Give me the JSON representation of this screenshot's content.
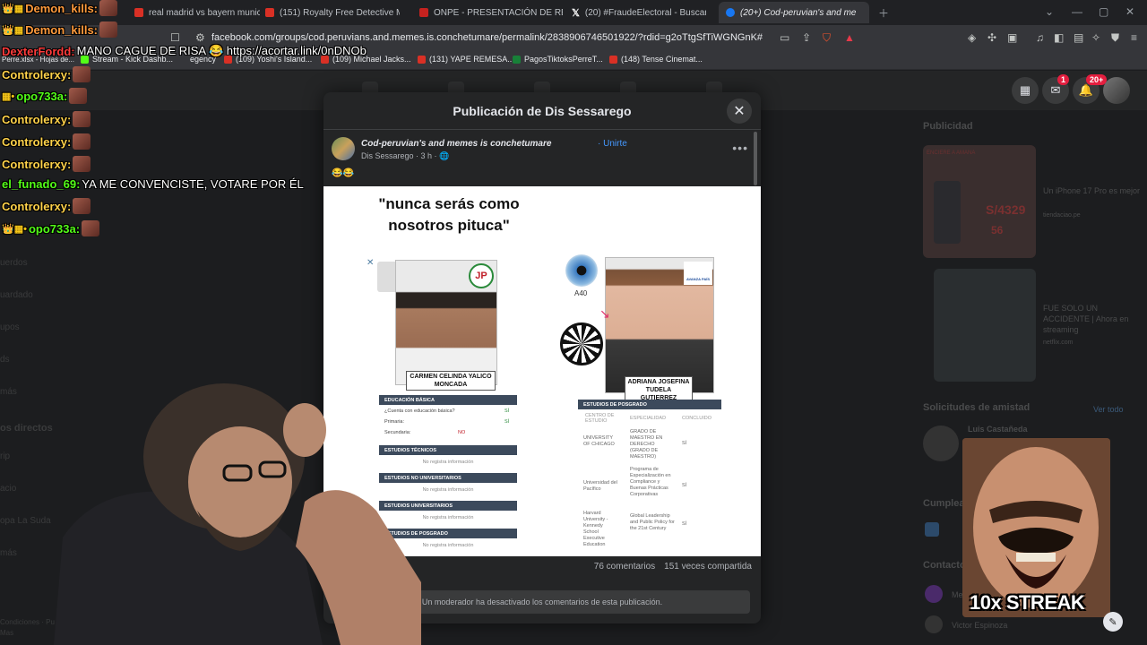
{
  "browser": {
    "tabs": [
      {
        "label": "real madrid vs bayern munich",
        "color": "#d93025"
      },
      {
        "label": "(151) Royalty Free Detective Mu",
        "color": "#d93025"
      },
      {
        "label": "ONPE - PRESENTACIÓN DE RESULTA",
        "color": "#c5221f"
      },
      {
        "label": "(20) #FraudeElectoral - Buscar / X",
        "color": "#ffffff"
      },
      {
        "label": "(20+) Cod-peruvian's and me",
        "color": "#1877f2"
      }
    ],
    "url": "facebook.com/groups/cod.peruvians.and.memes.is.conchetumare/permalink/2838906746501922/?rdid=g2oTtgSfTiWGNGnK#",
    "bookmarks": [
      {
        "label": "Stream - Kick Dashb...",
        "color": "#53fc18"
      },
      {
        "label": "(109) Yoshi's Island...",
        "color": "#d93025"
      },
      {
        "label": "(109) Michael Jacks...",
        "color": "#d93025"
      },
      {
        "label": "(131) YAPE REMESA...",
        "color": "#d93025"
      },
      {
        "label": "PagosTiktoksPerreT...",
        "color": "#188038"
      },
      {
        "label": "(148) Tense Cinemat...",
        "color": "#d93025"
      }
    ],
    "bookmarks_left": [
      "Kick Dashboard",
      "Perre.xlsx - Hojas de...",
      "egency"
    ]
  },
  "facebook": {
    "notif_badge": "1",
    "notif_badge_2": "20+",
    "left_menu": [
      "uerdos",
      "uardado",
      "upos",
      "ds",
      "más",
      "os directos",
      "rip",
      "acio",
      "opa La Suda",
      "más",
      "Condiciones · Pu",
      "Mas"
    ],
    "right": {
      "ads_title": "Publicidad",
      "ad1_text": "Un iPhone 17 Pro es mejor",
      "ad1_sub": "tiendaciao.pe",
      "ad1_price": "S/4329",
      "ad1_price2": "56",
      "ad1_banner": "ENCIERE A AMANA",
      "ad2_text": "FUE SOLO UN ACCIDENTE | Ahora en streaming",
      "ad2_sub": "netflix.com",
      "friends_title": "Solicitudes de amistad",
      "see_all": "Ver todo",
      "friend_name": "Luis Castañeda",
      "birthday_title": "Cumplea",
      "contacts_title": "Contacto",
      "contact1": "Mel",
      "contact2": "Victor Espinoza"
    }
  },
  "modal": {
    "title": "Publicación de Dis Sessarego",
    "group": "Cod-peruvian's and memes is conchetumare",
    "join": "· Unirte",
    "author": "Dis Sessarego · 3 h · 🌐",
    "emojis": "😂😂",
    "stats": {
      "comments": "76 comentarios",
      "shares": "151 veces compartida"
    },
    "footer": "Un moderador ha desactivado los comentarios de esta publicación."
  },
  "meme_image": {
    "quote": "\"nunca serás como nosotros pituca\"",
    "left_name": "CARMEN CELINDA YALICO MONCADA",
    "right_name": "ADRIANA JOSEFINA TUDELA GUTIERREZ",
    "left_sections": [
      "EDUCACIÓN BÁSICA",
      "ESTUDIOS TÉCNICOS",
      "ESTUDIOS NO UNIVERSITARIOS",
      "ESTUDIOS UNIVERSITARIOS",
      "ESTUDIOS DE POSGRADO"
    ],
    "left_rows": [
      "¿Cuenta con educación básica?",
      "Primaria:",
      "Secundaria:"
    ],
    "left_values": [
      "SÍ",
      "SÍ",
      "NO"
    ],
    "no_info": "No registra información",
    "right_section": "ESTUDIOS DE POSGRADO",
    "right_cols": [
      "CENTRO DE ESTUDIO",
      "ESPECIALIDAD",
      "CONCLUIDO"
    ],
    "right_rows": [
      {
        "center": "UNIVERSITY OF CHICAGO",
        "spec": "GRADO DE MAESTRO EN DERECHO (GRADO DE MAESTRO)",
        "done": "SÍ"
      },
      {
        "center": "Universidad del Pacífico",
        "spec": "Programa de Especialización en Compliance y Buenas Prácticas Corporativas",
        "done": "SÍ"
      },
      {
        "center": "Harvard University - Kennedy School Executive Education",
        "spec": "Global Leadership and Public Policy for the 21st Century",
        "done": "SÍ"
      }
    ],
    "eye_label": "A40",
    "party_left": "JP",
    "party_right": "AVANZA PAÍS"
  },
  "chat": [
    {
      "user": "Demon_kills:",
      "color": "#ff9a3c",
      "msg": "",
      "badge": "👑▦"
    },
    {
      "user": "Demon_kills:",
      "color": "#ff9a3c",
      "msg": "",
      "badge": "👑▦"
    },
    {
      "user": "DexterFordd:",
      "color": "#ff3b3b",
      "msg": "MANO CAGUE DE RISA 😂 https://acortar.link/0nDNOb",
      "badge": ""
    },
    {
      "user": "Controlerxy:",
      "color": "#ffd24a",
      "msg": "",
      "badge": ""
    },
    {
      "user": "opo733a:",
      "color": "#53fc18",
      "msg": "",
      "badge": "▦•"
    },
    {
      "user": "Controlerxy:",
      "color": "#ffd24a",
      "msg": "",
      "badge": ""
    },
    {
      "user": "Controlerxy:",
      "color": "#ffd24a",
      "msg": "",
      "badge": ""
    },
    {
      "user": "Controlerxy:",
      "color": "#ffd24a",
      "msg": "",
      "badge": ""
    },
    {
      "user": "el_funado_69:",
      "color": "#53fc18",
      "msg": "YA ME CONVENCISTE, VOTARE POR ÉL",
      "badge": ""
    },
    {
      "user": "Controlerxy:",
      "color": "#ffd24a",
      "msg": "",
      "badge": ""
    },
    {
      "user": "opo733a:",
      "color": "#53fc18",
      "msg": "",
      "badge": "👑▦•"
    }
  ],
  "overlay": {
    "streak": "10x STREAK"
  }
}
